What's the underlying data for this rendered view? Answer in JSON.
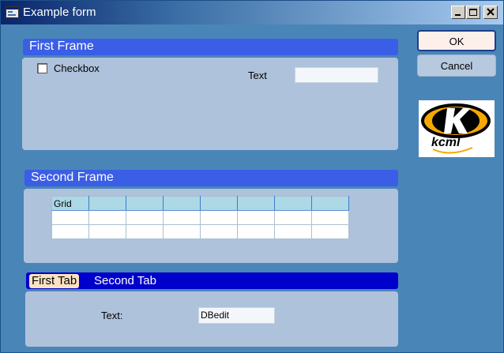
{
  "window": {
    "title": "Example form",
    "title_icon": "form-window-icon"
  },
  "first_frame": {
    "title": "First Frame",
    "checkbox_label": "Checkbox",
    "checkbox_checked": false,
    "text_label": "Text",
    "text_value": ""
  },
  "second_frame": {
    "title": "Second Frame",
    "grid": {
      "header": [
        "Grid",
        "",
        "",
        "",
        "",
        "",
        "",
        ""
      ],
      "rows": [
        [
          "",
          "",
          "",
          "",
          "",
          "",
          "",
          ""
        ],
        [
          "",
          "",
          "",
          "",
          "",
          "",
          "",
          ""
        ]
      ]
    }
  },
  "tabs": {
    "items": [
      {
        "label": "First Tab",
        "active": true
      },
      {
        "label": "Second Tab",
        "active": false
      }
    ],
    "text_label": "Text:",
    "dbedit_value": "DBedit"
  },
  "buttons": {
    "ok_label": "OK",
    "cancel_label": "Cancel"
  },
  "logo": {
    "text": "kcml",
    "colors": {
      "orange": "#f5a800",
      "black": "#000000"
    }
  },
  "colors": {
    "window_bg": "#4a85b8",
    "frame_header": "#3b5ee6",
    "frame_body": "#afc2db",
    "tab_bar": "#0000cc",
    "active_tab": "#fde2c2"
  }
}
